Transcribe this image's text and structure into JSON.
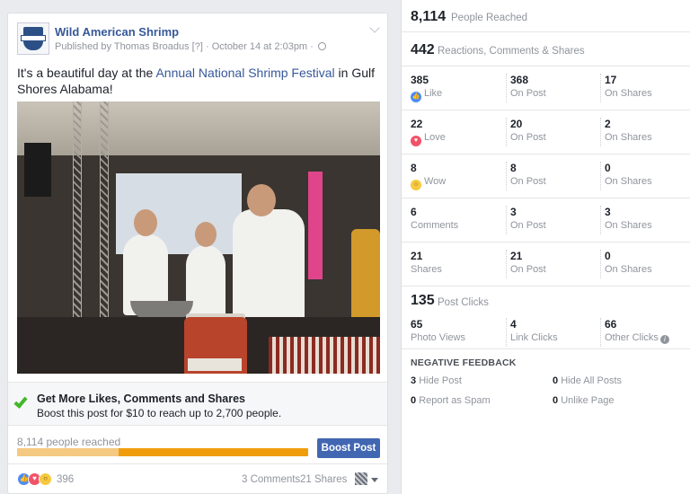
{
  "post": {
    "page_name": "Wild American Shrimp",
    "logo_alt": "Wild American Shrimp logo",
    "meta_published": "Published by Thomas Broadus",
    "meta_help": "[?]",
    "meta_date": "October 14 at 2:03pm",
    "text_before": "It's a beautiful day at the ",
    "text_link": "Annual National Shrimp Festival",
    "text_after": " in Gulf Shores Alabama!",
    "photo_description": "Chefs cooking under a tent at the Annual National Shrimp Festival"
  },
  "boost": {
    "title": "Get More Likes, Comments and Shares",
    "description": "Boost this post for $10 to reach up to 2,700 people.",
    "reach_text": "8,114 people reached",
    "progress_fraction": 0.35,
    "button_label": "Boost Post"
  },
  "footer": {
    "reaction_count": "396",
    "comments": "3 Comments",
    "shares": "21 Shares"
  },
  "insights": {
    "people_reached": {
      "value": "8,114",
      "label": "People Reached"
    },
    "engagement": {
      "value": "442",
      "label": "Reactions, Comments & Shares"
    },
    "breakdown": [
      {
        "total": "385",
        "name": "Like",
        "icon": "like",
        "on_post": "368",
        "on_shares": "17"
      },
      {
        "total": "22",
        "name": "Love",
        "icon": "love",
        "on_post": "20",
        "on_shares": "2"
      },
      {
        "total": "8",
        "name": "Wow",
        "icon": "wow",
        "on_post": "8",
        "on_shares": "0"
      },
      {
        "total": "6",
        "name": "Comments",
        "icon": "",
        "on_post": "3",
        "on_shares": "3"
      },
      {
        "total": "21",
        "name": "Shares",
        "icon": "",
        "on_post": "21",
        "on_shares": "0"
      }
    ],
    "on_post_label": "On Post",
    "on_shares_label": "On Shares",
    "post_clicks": {
      "value": "135",
      "label": "Post Clicks"
    },
    "clicks": [
      {
        "value": "65",
        "label": "Photo Views"
      },
      {
        "value": "4",
        "label": "Link Clicks"
      },
      {
        "value": "66",
        "label": "Other Clicks"
      }
    ],
    "negative_feedback": {
      "title": "NEGATIVE FEEDBACK",
      "hide_post": {
        "value": "3",
        "label": "Hide Post"
      },
      "hide_all": {
        "value": "0",
        "label": "Hide All Posts"
      },
      "report_spam": {
        "value": "0",
        "label": "Report as Spam"
      },
      "unlike_page": {
        "value": "0",
        "label": "Unlike Page"
      }
    }
  },
  "colors": {
    "link": "#365899",
    "boost_button": "#4267b2",
    "progress": "#f09d0c",
    "check": "#42b72a"
  }
}
